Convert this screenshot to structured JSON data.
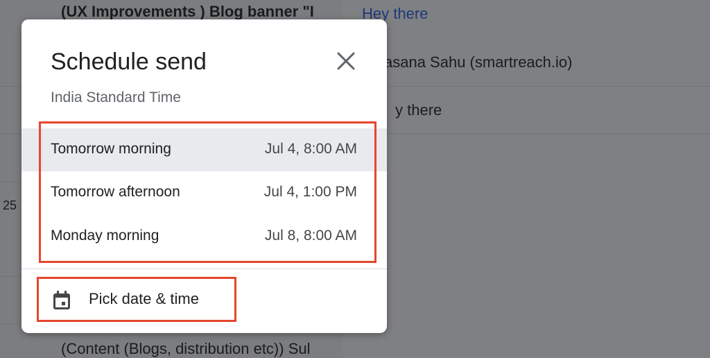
{
  "background": {
    "rows": [
      {
        "text": "(UX Improvements ) Blog banner \"I"
      },
      {
        "text": "25"
      },
      {
        "text": "(Content (Blogs, distribution etc)) Sul"
      }
    ],
    "right_rows": [
      {
        "text": "Hey there"
      },
      {
        "text": "asana Sahu (smartreach.io)"
      },
      {
        "text": "y there"
      }
    ]
  },
  "dialog": {
    "title": "Schedule send",
    "subtitle": "India Standard Time",
    "close_icon": "close-icon",
    "options": [
      {
        "label": "Tomorrow morning",
        "time": "Jul 4, 8:00 AM",
        "highlighted": true
      },
      {
        "label": "Tomorrow afternoon",
        "time": "Jul 4, 1:00 PM",
        "highlighted": false
      },
      {
        "label": "Monday morning",
        "time": "Jul 8, 8:00 AM",
        "highlighted": false
      }
    ],
    "pick": {
      "label": "Pick date & time",
      "icon": "calendar-icon"
    }
  },
  "colors": {
    "annotation": "#e5462c",
    "hover": "#e8eaed"
  }
}
